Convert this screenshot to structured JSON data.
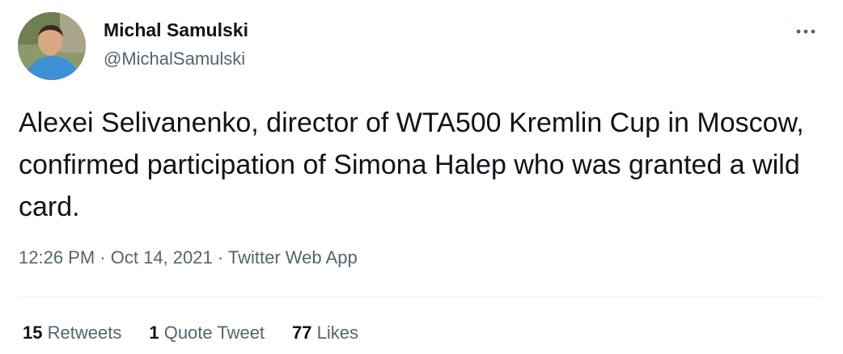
{
  "author": {
    "display_name": "Michal Samulski",
    "handle": "@MichalSamulski",
    "avatar_icon": "user-avatar-photo"
  },
  "more_icon": "more-options-icon",
  "tweet": {
    "text": "Alexei Selivanenko, director of WTA500 Kremlin Cup in Moscow, confirmed participation of Simona Halep who was granted a wild card."
  },
  "meta": {
    "time": "12:26 PM",
    "separator": "·",
    "date": "Oct 14, 2021",
    "source": "Twitter Web App"
  },
  "stats": {
    "retweets": {
      "count": "15",
      "label": "Retweets"
    },
    "quote_tweets": {
      "count": "1",
      "label": "Quote Tweet"
    },
    "likes": {
      "count": "77",
      "label": "Likes"
    }
  },
  "colors": {
    "primary_text": "#0f1419",
    "secondary_text": "#536471",
    "divider": "#e6ecf0"
  }
}
